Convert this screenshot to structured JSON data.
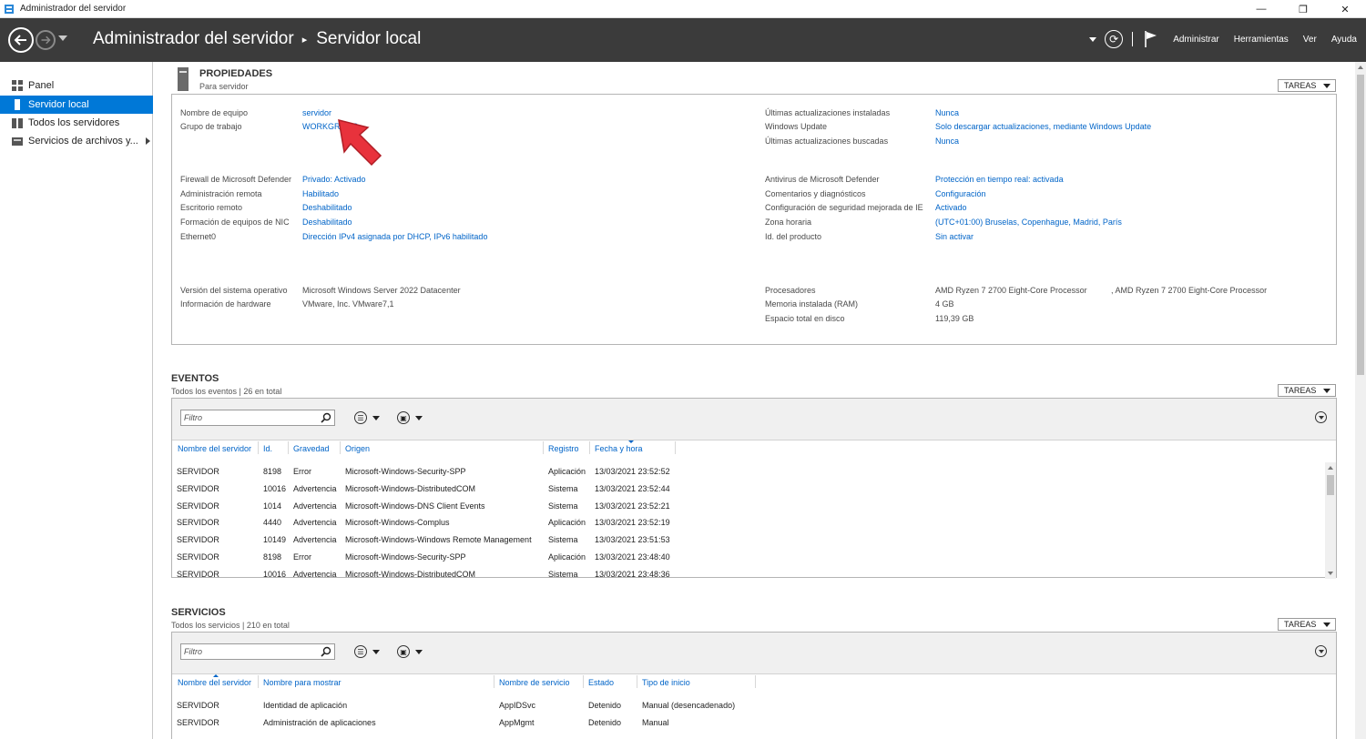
{
  "window": {
    "title": "Administrador del servidor",
    "controls": [
      "—",
      "❐",
      "✕"
    ]
  },
  "header": {
    "app": "Administrador del servidor",
    "page": "Servidor local",
    "menus": [
      "Administrar",
      "Herramientas",
      "Ver",
      "Ayuda"
    ]
  },
  "sidebar": {
    "items": [
      {
        "label": "Panel",
        "icon": "dashboard-icon",
        "active": false
      },
      {
        "label": "Servidor local",
        "icon": "server-icon",
        "active": true
      },
      {
        "label": "Todos los servidores",
        "icon": "servers-icon",
        "active": false
      },
      {
        "label": "Servicios de archivos y...",
        "icon": "file-services-icon",
        "active": false
      }
    ]
  },
  "properties": {
    "title": "PROPIEDADES",
    "subtitle": "Para servidor",
    "tasks": "TAREAS",
    "left": [
      {
        "label": "Nombre de equipo",
        "value": "servidor",
        "link": true
      },
      {
        "label": "Grupo de trabajo",
        "value": "WORKGROUP",
        "link": true
      },
      {
        "label": "Firewall de Microsoft Defender",
        "value": "Privado: Activado",
        "link": true
      },
      {
        "label": "Administración remota",
        "value": "Habilitado",
        "link": true
      },
      {
        "label": "Escritorio remoto",
        "value": "Deshabilitado",
        "link": true
      },
      {
        "label": "Formación de equipos de NIC",
        "value": "Deshabilitado",
        "link": true
      },
      {
        "label": "Ethernet0",
        "value": "Dirección IPv4 asignada por DHCP, IPv6 habilitado",
        "link": true
      },
      {
        "label": "Versión del sistema operativo",
        "value": "Microsoft Windows Server 2022 Datacenter",
        "link": false
      },
      {
        "label": "Información de hardware",
        "value": "VMware, Inc. VMware7,1",
        "link": false
      }
    ],
    "right": [
      {
        "label": "Últimas actualizaciones instaladas",
        "value": "Nunca",
        "link": true
      },
      {
        "label": "Windows Update",
        "value": "Solo descargar actualizaciones, mediante Windows Update",
        "link": true
      },
      {
        "label": "Últimas actualizaciones buscadas",
        "value": "Nunca",
        "link": true
      },
      {
        "label": "Antivirus de Microsoft Defender",
        "value": "Protección en tiempo real: activada",
        "link": true
      },
      {
        "label": "Comentarios y diagnósticos",
        "value": "Configuración",
        "link": true
      },
      {
        "label": "Configuración de seguridad mejorada de IE",
        "value": "Activado",
        "link": true
      },
      {
        "label": "Zona horaria",
        "value": "(UTC+01:00) Bruselas, Copenhague, Madrid, París",
        "link": true
      },
      {
        "label": "Id. del producto",
        "value": "Sin activar",
        "link": true
      },
      {
        "label": "Procesadores",
        "value": "AMD Ryzen 7 2700 Eight-Core Processor",
        "value2": ", AMD Ryzen 7 2700 Eight-Core Processor",
        "link": false
      },
      {
        "label": "Memoria instalada (RAM)",
        "value": "4 GB",
        "link": false
      },
      {
        "label": "Espacio total en disco",
        "value": "119,39 GB",
        "link": false
      }
    ]
  },
  "events": {
    "title": "EVENTOS",
    "subtitle": "Todos los eventos | 26 en total",
    "tasks": "TAREAS",
    "filter_placeholder": "Filtro",
    "columns": [
      "Nombre del servidor",
      "Id.",
      "Gravedad",
      "Origen",
      "Registro",
      "Fecha y hora"
    ],
    "rows": [
      [
        "SERVIDOR",
        "8198",
        "Error",
        "Microsoft-Windows-Security-SPP",
        "Aplicación",
        "13/03/2021 23:52:52"
      ],
      [
        "SERVIDOR",
        "10016",
        "Advertencia",
        "Microsoft-Windows-DistributedCOM",
        "Sistema",
        "13/03/2021 23:52:44"
      ],
      [
        "SERVIDOR",
        "1014",
        "Advertencia",
        "Microsoft-Windows-DNS Client Events",
        "Sistema",
        "13/03/2021 23:52:21"
      ],
      [
        "SERVIDOR",
        "4440",
        "Advertencia",
        "Microsoft-Windows-Complus",
        "Aplicación",
        "13/03/2021 23:52:19"
      ],
      [
        "SERVIDOR",
        "10149",
        "Advertencia",
        "Microsoft-Windows-Windows Remote Management",
        "Sistema",
        "13/03/2021 23:51:53"
      ],
      [
        "SERVIDOR",
        "8198",
        "Error",
        "Microsoft-Windows-Security-SPP",
        "Aplicación",
        "13/03/2021 23:48:40"
      ],
      [
        "SERVIDOR",
        "10016",
        "Advertencia",
        "Microsoft-Windows-DistributedCOM",
        "Sistema",
        "13/03/2021 23:48:36"
      ]
    ]
  },
  "services": {
    "title": "SERVICIOS",
    "subtitle": "Todos los servicios | 210 en total",
    "tasks": "TAREAS",
    "filter_placeholder": "Filtro",
    "columns": [
      "Nombre del servidor",
      "Nombre para mostrar",
      "Nombre de servicio",
      "Estado",
      "Tipo de inicio"
    ],
    "rows": [
      [
        "SERVIDOR",
        "Identidad de aplicación",
        "AppIDSvc",
        "Detenido",
        "Manual (desencadenado)"
      ],
      [
        "SERVIDOR",
        "Administración de aplicaciones",
        "AppMgmt",
        "Detenido",
        "Manual"
      ]
    ]
  },
  "colors": {
    "header_bg": "#3b3b3b",
    "accent": "#0078d7",
    "link": "#0064c8",
    "pointer": "#e8323c"
  }
}
